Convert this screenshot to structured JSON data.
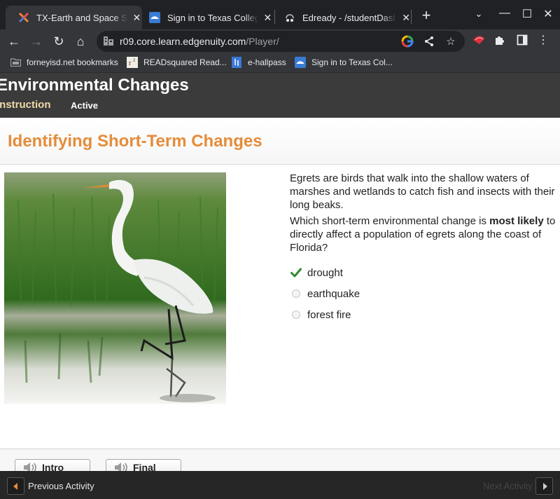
{
  "browser": {
    "tabs": [
      {
        "title": "TX-Earth and Space Science",
        "icon": "edgenuity-x-icon",
        "active": true
      },
      {
        "title": "Sign in to Texas College Bridge",
        "icon": "texas-college-icon",
        "active": false
      },
      {
        "title": "Edready - /studentDashboard",
        "icon": "edready-icon",
        "active": false
      }
    ],
    "new_tab_label": "+",
    "url_host": "r09.core.learn.edgenuity.com",
    "url_path": "/Player/",
    "bookmarks": [
      {
        "label": "forneyisd.net bookmarks",
        "icon": "folder-icon"
      },
      {
        "label": "READsquared Read...",
        "icon": "readsquared-icon"
      },
      {
        "label": "e-hallpass",
        "icon": "e-hallpass-icon"
      },
      {
        "label": "Sign in to Texas Col...",
        "icon": "texas-college-icon"
      }
    ]
  },
  "lesson": {
    "title": "Environmental Changes",
    "tabs": [
      {
        "label": "Instruction",
        "state": "current"
      },
      {
        "label": "Active",
        "state": "normal"
      }
    ]
  },
  "activity": {
    "title": "Identifying Short-Term Changes",
    "image_alt": "Great egret wading in marsh water among tall green grass",
    "question_intro": "Egrets are birds that walk into the shallow waters of marshes and wetlands to catch fish and insects with their long beaks.",
    "question_part1": "Which short-term environmental change is ",
    "question_bold": "most likely",
    "question_part2": " to directly affect a population of egrets along the coast of Florida?",
    "choices": [
      {
        "label": "drought",
        "state": "correct-selected"
      },
      {
        "label": "earthquake",
        "state": "unselected"
      },
      {
        "label": "forest fire",
        "state": "unselected"
      }
    ],
    "audio_buttons": [
      {
        "label": "Intro",
        "icon": "speaker-icon"
      },
      {
        "label": "Final",
        "icon": "speaker-icon"
      }
    ]
  },
  "footer": {
    "previous_label": "Previous Activity",
    "next_label": "Next Activity",
    "next_enabled": false
  },
  "colors": {
    "accent_orange": "#e58c3a",
    "check_green": "#2e8b2e",
    "header_dark": "#3b3b3b"
  }
}
